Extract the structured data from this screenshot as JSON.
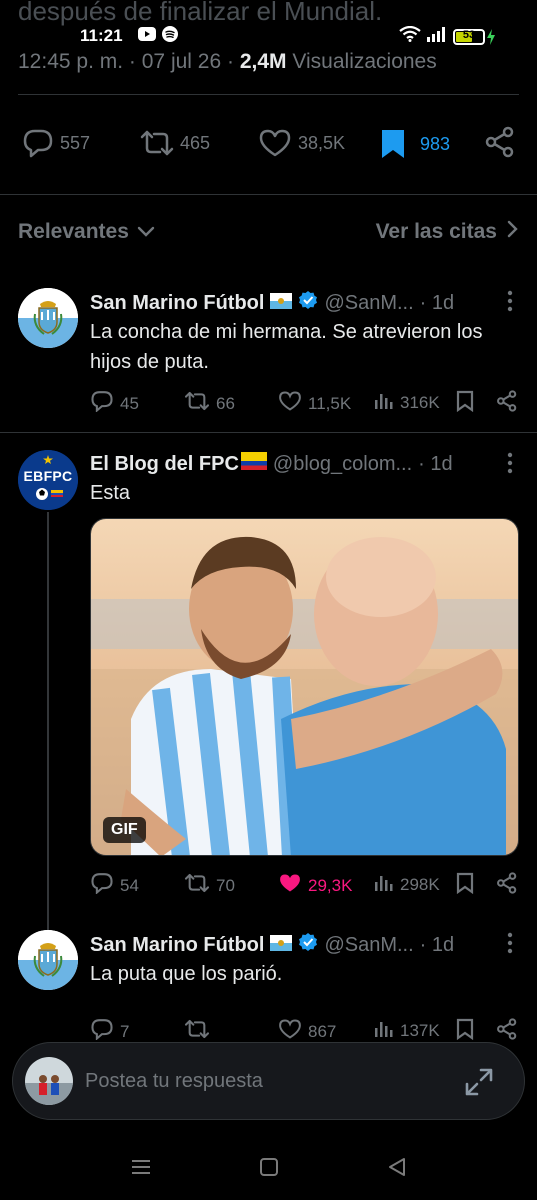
{
  "status_bar": {
    "time": "11:21",
    "battery": "53",
    "scrolled_text": "después de finalizar el Mundial."
  },
  "post_meta": {
    "time": "12:45 p. m.",
    "sep1": "·",
    "date": "07 jul 26",
    "sep2": "·",
    "views": "2,4M",
    "views_label": "Visualizaciones"
  },
  "post_actions": {
    "replies": "557",
    "reposts": "465",
    "likes": "38,5K",
    "bookmarks": "983"
  },
  "sort": {
    "label": "Relevantes",
    "quotes_label": "Ver las citas"
  },
  "replies": [
    {
      "name": "San Marino Fútbol",
      "handle": "@SanM...",
      "time": "· 1d",
      "text": "La concha de mi hermana. Se atrevieron los hijos de puta.",
      "replies": "45",
      "reposts": "66",
      "likes": "11,5K",
      "views": "316K"
    },
    {
      "name": "El Blog del FPC",
      "handle": "@blog_colom...",
      "time": "· 1d",
      "text": "Esta",
      "avatar_text": "EBFPC",
      "media_badge": "GIF",
      "replies": "54",
      "reposts": "70",
      "likes": "29,3K",
      "views": "298K"
    },
    {
      "name": "San Marino Fútbol",
      "handle": "@SanM...",
      "time": "· 1d",
      "text": "La puta que los parió.",
      "replies": "7",
      "reposts": "",
      "likes": "867",
      "views": "137K"
    }
  ],
  "reply_box": {
    "placeholder": "Postea tu respuesta"
  },
  "colors": {
    "background": "#000000",
    "muted": "#71767b",
    "accent_blue": "#1d9bf0",
    "like_pink": "#f91880",
    "verified_blue": "#1d9bf0"
  }
}
